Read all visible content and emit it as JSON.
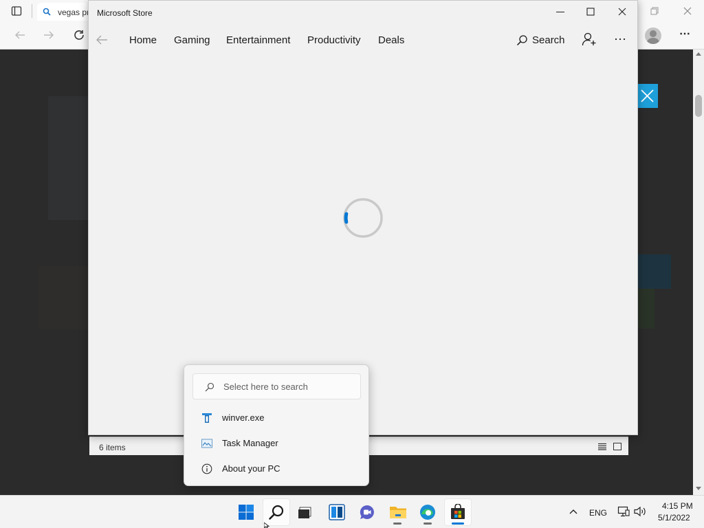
{
  "browser": {
    "tab_title": "vegas pro"
  },
  "store": {
    "window_title": "Microsoft Store",
    "nav": {
      "home": "Home",
      "gaming": "Gaming",
      "entertainment": "Entertainment",
      "productivity": "Productivity",
      "deals": "Deals",
      "search": "Search"
    },
    "state": "loading"
  },
  "explorer": {
    "item_count": "6 items"
  },
  "start_search": {
    "placeholder": "Select here to search",
    "items": [
      {
        "label": "winver.exe",
        "icon": "winver-icon"
      },
      {
        "label": "Task Manager",
        "icon": "task-manager-icon"
      },
      {
        "label": "About your PC",
        "icon": "info-icon"
      }
    ]
  },
  "taskbar": {
    "apps": [
      "start",
      "search",
      "task-view",
      "widgets",
      "chat",
      "file-explorer",
      "edge",
      "microsoft-store"
    ],
    "language": "ENG",
    "time": "4:15 PM",
    "date": "5/1/2022"
  },
  "colors": {
    "accent": "#0078d4",
    "blue_close": "#1ea0db"
  }
}
